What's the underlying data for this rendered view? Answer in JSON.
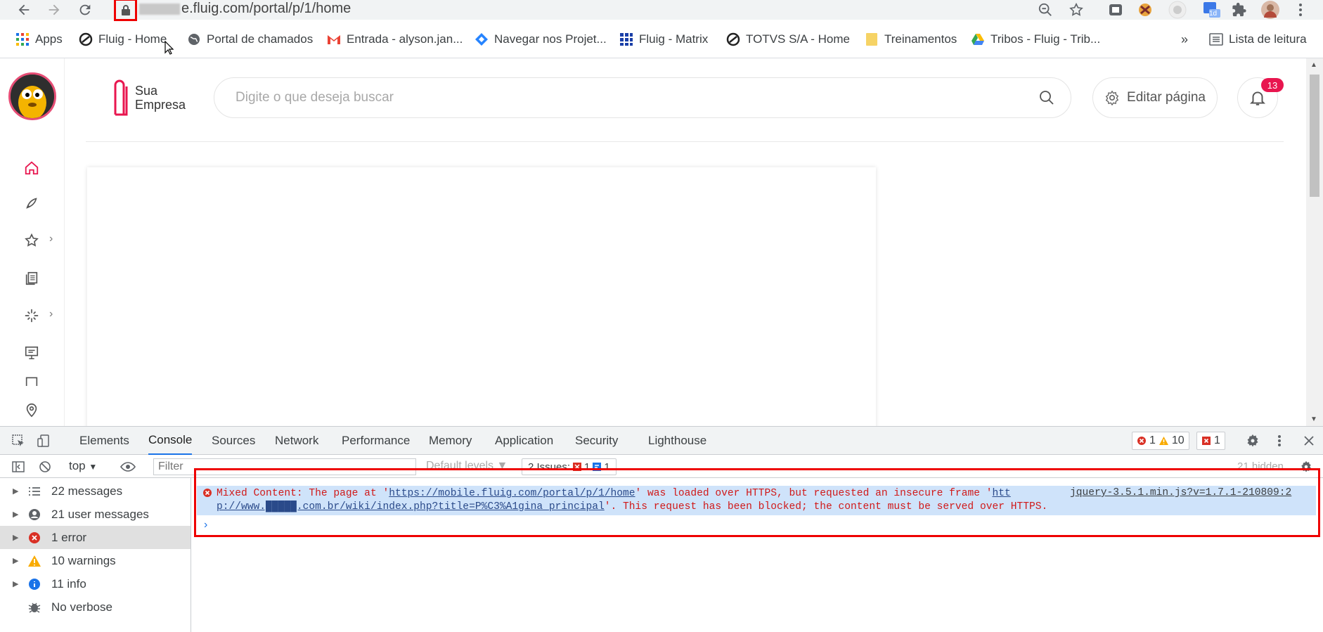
{
  "browser": {
    "url_visible": "e.fluig.com/portal/p/1/home",
    "bookmarks": [
      {
        "label": "Apps",
        "icon": "apps-grid-icon"
      },
      {
        "label": "Fluig - Home",
        "icon": "fluig-icon"
      },
      {
        "label": "Portal de chamados",
        "icon": "globe-icon"
      },
      {
        "label": "Entrada - alyson.jan...",
        "icon": "gmail-icon"
      },
      {
        "label": "Navegar nos Projet...",
        "icon": "jira-icon"
      },
      {
        "label": "Fluig - Matrix",
        "icon": "grid-icon"
      },
      {
        "label": "TOTVS S/A - Home",
        "icon": "totvs-icon"
      },
      {
        "label": "Treinamentos",
        "icon": "folder-icon"
      },
      {
        "label": "Tribos - Fluig - Trib...",
        "icon": "drive-icon"
      }
    ],
    "overflow_label": "»",
    "reading_list": "Lista de leitura",
    "extension_badge": "1d"
  },
  "page": {
    "logo_line1": "Sua",
    "logo_line2": "Empresa",
    "search_placeholder": "Digite o que deseja buscar",
    "edit_button": "Editar página",
    "notifications_count": "13"
  },
  "devtools": {
    "tabs": [
      "Elements",
      "Console",
      "Sources",
      "Network",
      "Performance",
      "Memory",
      "Application",
      "Security",
      "Lighthouse"
    ],
    "active_tab": "Console",
    "errors_count": "1",
    "warnings_count": "10",
    "issues_badge": "1",
    "context": "top",
    "filter_placeholder": "Filter",
    "default_levels": "Default levels ▼",
    "issues_label": "2 Issues:",
    "issues_error": "1",
    "issues_info": "1",
    "hidden": "21 hidden",
    "sidebar": [
      {
        "label": "22 messages",
        "icon": "list-icon"
      },
      {
        "label": "21 user messages",
        "icon": "user-icon"
      },
      {
        "label": "1 error",
        "icon": "error-icon"
      },
      {
        "label": "10 warnings",
        "icon": "warning-icon"
      },
      {
        "label": "11 info",
        "icon": "info-icon"
      },
      {
        "label": "No verbose",
        "icon": "bug-icon"
      }
    ],
    "error": {
      "part1": "Mixed Content: The page at '",
      "url1": "https://mobile.fluig.com/portal/p/1/home",
      "part2": "' was loaded over HTTPS, but requested an insecure frame '",
      "url2a": "htt",
      "url2b": "p://www.█████.com.br/wiki/index.php?title=P%C3%A1gina_principal",
      "part3": "'. This request has been blocked; the content must be served over HTTPS.",
      "source": "jquery-3.5.1.min.js?v=1.7.1-210809:2"
    }
  }
}
